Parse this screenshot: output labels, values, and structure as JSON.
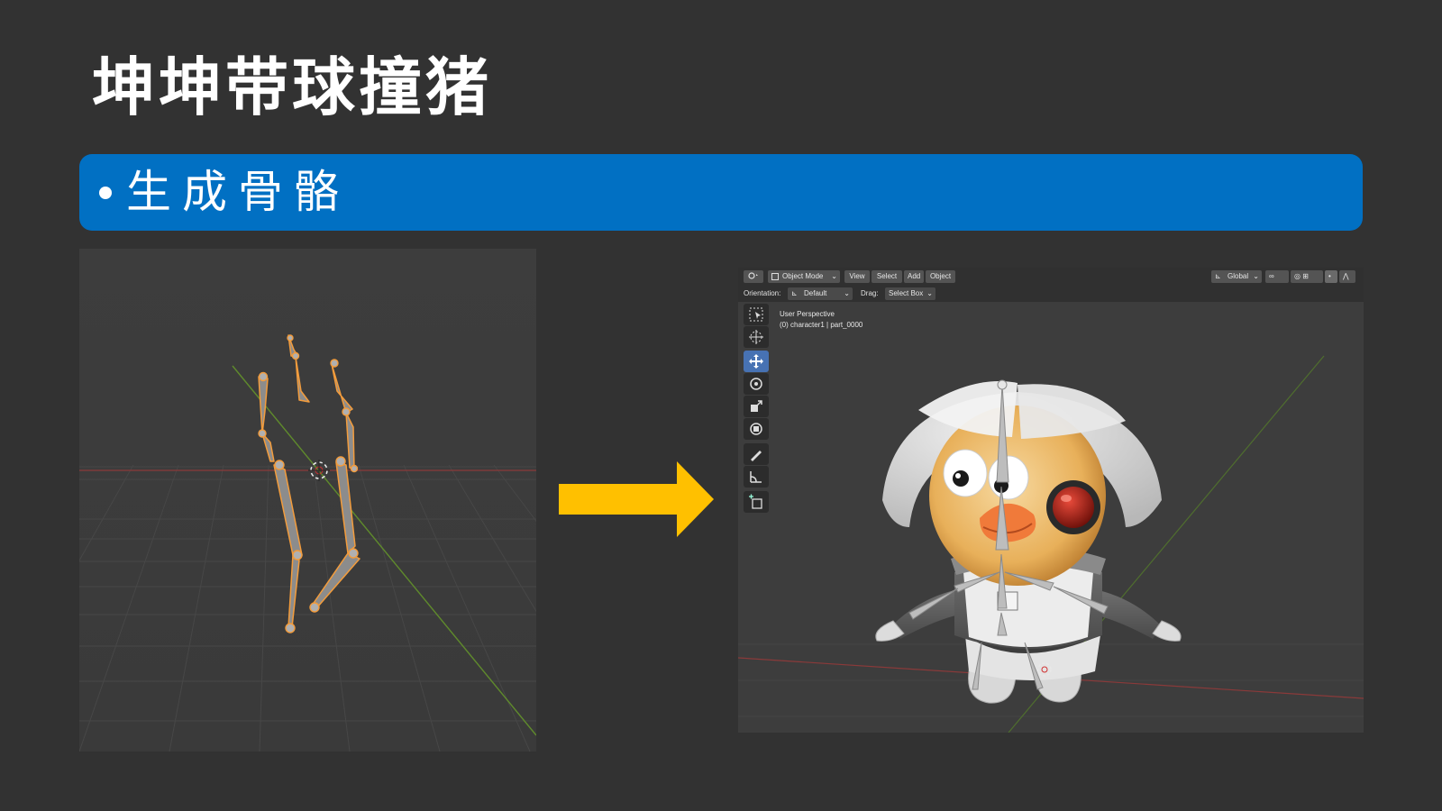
{
  "slide": {
    "title": "坤坤带球撞猪",
    "bullet_text": "生成骨骼",
    "colors": {
      "background": "#323232",
      "banner": "#0170c3",
      "arrow": "#ffc000",
      "bone_outline": "#f39c3c"
    }
  },
  "blender": {
    "header": {
      "editor_icon": "viewport-editor-icon",
      "mode": "Object Mode",
      "menus": [
        "View",
        "Select",
        "Add",
        "Object"
      ],
      "transform_orientation": "Global"
    },
    "tool_settings": {
      "orientation_label": "Orientation:",
      "orientation_value": "Default",
      "drag_label": "Drag:",
      "drag_value": "Select Box"
    },
    "viewport": {
      "perspective": "User Perspective",
      "object_info": "(0) character1 | part_0000"
    },
    "tools": [
      "select-box-icon",
      "cursor-icon",
      "move-icon",
      "rotate-icon",
      "scale-icon",
      "transform-icon",
      "annotate-icon",
      "measure-icon",
      "add-cube-icon"
    ]
  }
}
